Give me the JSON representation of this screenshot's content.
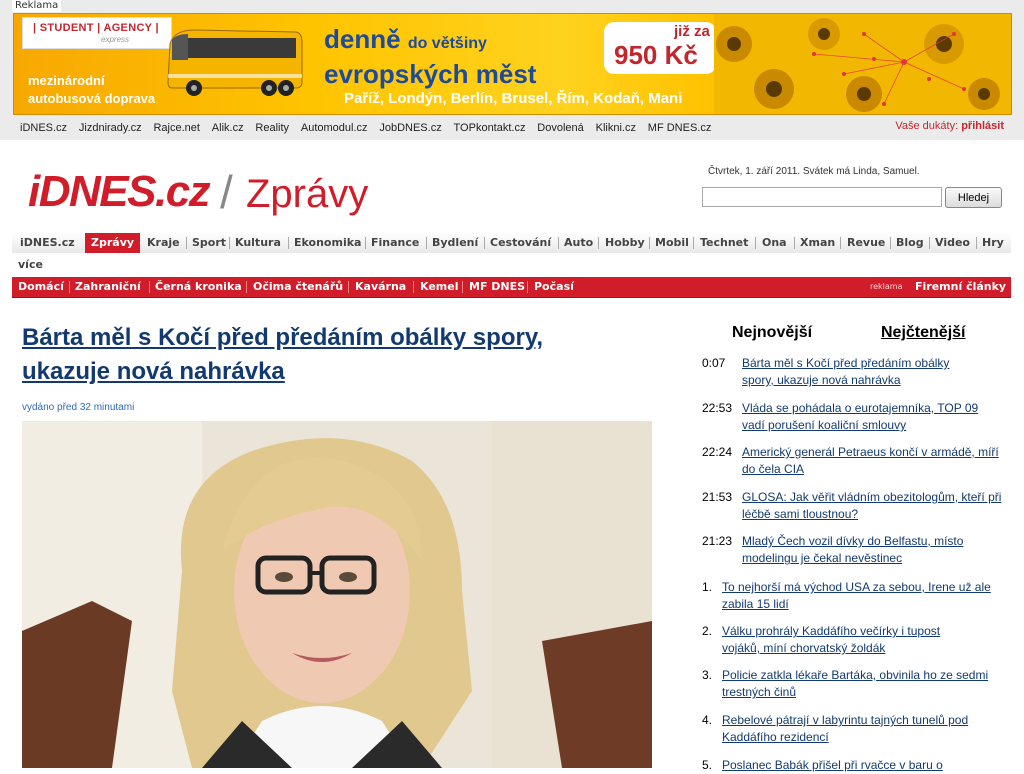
{
  "ad": {
    "tag": "Reklama",
    "brand_line1": "| STUDENT | AGENCY |",
    "brand_line2": "express",
    "left_line1": "mezinárodní",
    "left_line2": "autobusová doprava",
    "headline_big1": "denně",
    "headline_small": "do většiny",
    "headline_big2": "evropských měst",
    "cities": "Paříž, Londýn, Berlín, Brusel, Řím, Kodaň, Mani",
    "price_prefix": "již za",
    "price_value": "950 Kč"
  },
  "partners": [
    "iDNES.cz",
    "Jizdnirady.cz",
    "Rajce.net",
    "Alik.cz",
    "Reality",
    "Automodul.cz",
    "JobDNES.cz",
    "TOPkontakt.cz",
    "Dovolená",
    "Klikni.cz",
    "MF DNES.cz"
  ],
  "login": {
    "label": "Vaše dukáty:",
    "link": "přihlásit"
  },
  "header": {
    "logo": "iDNES.cz",
    "slash": "/",
    "section": "Zprávy",
    "date": "Čtvrtek, 1. září 2011. Svátek má Linda, Samuel.",
    "search_button": "Hledej",
    "search_value": ""
  },
  "mainnav": [
    "iDNES.cz",
    "Zprávy",
    "Kraje",
    "Sport",
    "Kultura",
    "Ekonomika",
    "Finance",
    "Bydlení",
    "Cestování",
    "Auto",
    "Hobby",
    "Mobil",
    "Technet",
    "Ona",
    "Xman",
    "Revue",
    "Blog",
    "Video",
    "Hry"
  ],
  "mainnav_more": "více",
  "subnav": [
    "Domácí",
    "Zahraniční",
    "Černá kronika",
    "Očima čtenářů",
    "Kavárna",
    "Kemel",
    "MF DNES",
    "Počasí"
  ],
  "subnav_ad": "reklama",
  "subnav_right": "Firemní články",
  "article": {
    "headline": "Bárta měl s Kočí před předáním obálky spory, ukazuje nová nahrávka",
    "published": "vydáno před 32 minutami"
  },
  "sidebar": {
    "tab_newest": "Nejnovější",
    "tab_most_read": "Nejčtenější",
    "newest": [
      {
        "time": "0:07",
        "title": "Bárta měl s Kočí před předáním obálky spory, ukazuje nová nahrávka"
      },
      {
        "time": "22:53",
        "title": "Vláda se pohádala o eurotajemníka, TOP 09 vadí porušení koaliční smlouvy"
      },
      {
        "time": "22:24",
        "title": "Americký generál Petraeus končí v armádě, míří do čela CIA"
      },
      {
        "time": "21:53",
        "title": "GLOSA: Jak věřit vládním obezitologům, kteří při léčbě sami tloustnou?"
      },
      {
        "time": "21:23",
        "title": "Mladý Čech vozil dívky do Belfastu, místo modelingu je čekal nevěstinec"
      }
    ],
    "most_read": [
      {
        "rank": "1.",
        "title": "To nejhorší má východ USA za sebou, Irene už ale zabila 15 lidí"
      },
      {
        "rank": "2.",
        "title": "Válku prohrály Kaddáfího večírky i tupost vojáků, míní chorvatský žoldák"
      },
      {
        "rank": "3.",
        "title": "Policie zatkla lékaře Bartáka, obvinila ho ze sedmi trestných činů"
      },
      {
        "rank": "4.",
        "title": "Rebelové pátrají v labyrintu tajných tunelů pod Kaddáfího rezidencí"
      },
      {
        "rank": "5.",
        "title": "Poslanec Babák přišel při rvačce v baru o"
      }
    ]
  },
  "colors": {
    "brand_red": "#d11d2a",
    "link_blue": "#123a70",
    "ad_yellow": "#ffc400"
  },
  "icons": {
    "bus": "bus-illustration",
    "map": "europe-map-illustration",
    "photo": "article-photo-woman"
  }
}
